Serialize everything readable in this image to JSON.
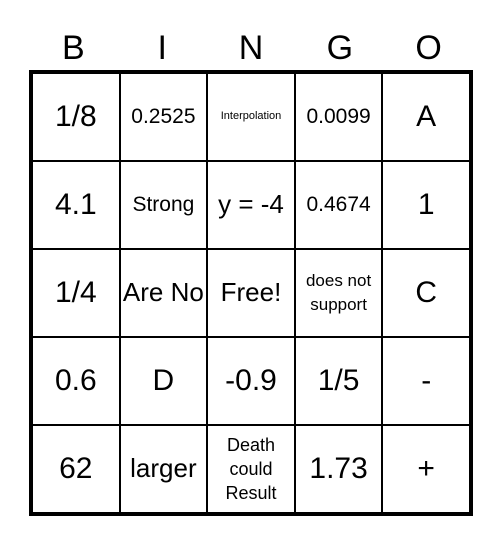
{
  "header": [
    "B",
    "I",
    "N",
    "G",
    "O"
  ],
  "cells": [
    "1/8",
    "0.2525",
    "Interpolation",
    "0.0099",
    "A",
    "4.1",
    "Strong",
    "y = -4",
    "0.4674",
    "1",
    "1/4",
    "Are No",
    "Free!",
    "does not support",
    "C",
    "0.6",
    "D",
    "-0.9",
    "1/5",
    "-",
    "62",
    "larger",
    "Death could Result",
    "1.73",
    "+"
  ]
}
